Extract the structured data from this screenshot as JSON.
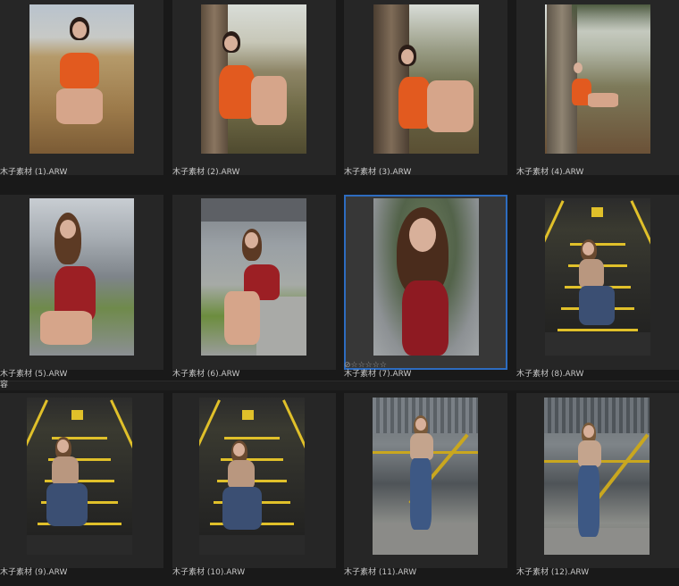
{
  "grid": {
    "items": [
      {
        "caption": "木子素材 (1).ARW",
        "scene": "portrait in orange dress sitting in dry grass field"
      },
      {
        "caption": "木子素材 (2).ARW",
        "scene": "portrait in orange dress against tree trunk"
      },
      {
        "caption": "木子素材 (3).ARW",
        "scene": "portrait in orange dress leaning on tree"
      },
      {
        "caption": "木子素材 (4).ARW",
        "scene": "wide shot under large tree"
      },
      {
        "caption": "木子素材 (5).ARW",
        "scene": "portrait in red polka dress sitting on ledge"
      },
      {
        "caption": "木子素材 (6).ARW",
        "scene": "sitting on concrete wall under bridge"
      },
      {
        "caption": "木子素材 (7).ARW",
        "scene": "close portrait in red polka dress",
        "rating": "☆☆☆☆☆",
        "reject_icon": "⊘"
      },
      {
        "caption": "木子素材 (8).ARW",
        "scene": "sitting on yellow staircase"
      },
      {
        "caption": "木子素材 (9).ARW",
        "scene": "sitting on yellow staircase"
      },
      {
        "caption": "木子素材 (10).ARW",
        "scene": "sitting on yellow staircase"
      },
      {
        "caption": "木子素材 (11).ARW",
        "scene": "standing by metal railing"
      },
      {
        "caption": "木子素材 (12).ARW",
        "scene": "standing by metal railing"
      }
    ]
  },
  "group": {
    "label": "容"
  },
  "colors": {
    "selection": "#2d6cc0",
    "stair_yellow": "#e0c02a"
  }
}
